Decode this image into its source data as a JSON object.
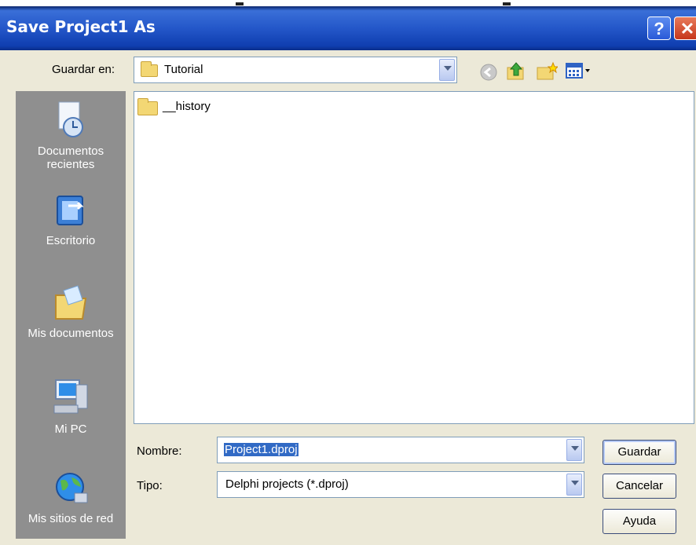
{
  "window": {
    "title": "Save Project1 As",
    "help_label": "?",
    "close_label": "✕"
  },
  "location": {
    "label": "Guardar en:",
    "value": "Tutorial"
  },
  "toolbar": {
    "icons": [
      "back-icon",
      "up-folder-icon",
      "new-folder-icon",
      "view-menu-icon"
    ]
  },
  "places": [
    {
      "label": "Documentos recientes",
      "icon": "recent-documents-icon"
    },
    {
      "label": "Escritorio",
      "icon": "desktop-icon"
    },
    {
      "label": "Mis documentos",
      "icon": "my-documents-icon"
    },
    {
      "label": "Mi PC",
      "icon": "my-computer-icon"
    },
    {
      "label": "Mis sitios de red",
      "icon": "network-places-icon"
    }
  ],
  "files": [
    {
      "name": "__history",
      "icon": "folder-icon"
    }
  ],
  "filename": {
    "label": "Nombre:",
    "value": "Project1.dproj"
  },
  "filetype": {
    "label": "Tipo:",
    "value": "Delphi projects (*.dproj)"
  },
  "buttons": {
    "save": "Guardar",
    "cancel": "Cancelar",
    "help": "Ayuda"
  }
}
